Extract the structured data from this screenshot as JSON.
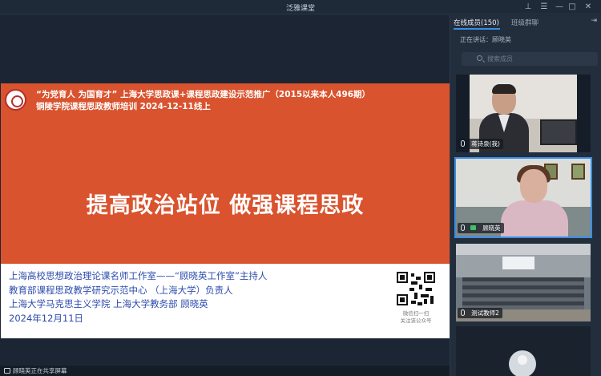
{
  "window": {
    "title": "泛雅课堂"
  },
  "slide": {
    "header_line1": "“为党育人 为国育才” 上海大学思政课+课程思政建设示范推广（2015以来本人496期）",
    "header_line2": "铜陵学院课程思政教师培训 2024-12-11线上",
    "main_title": "提高政治站位 做强课程思政",
    "body_lines": [
      "上海高校思想政治理论课名师工作室——“顾晓英工作室”主持人",
      "教育部课程思政教学研究示范中心 （上海大学）负责人",
      "上海大学马克思主义学院 上海大学教务部 顾晓英",
      "2024年12月11日"
    ],
    "qr_caption": [
      "微信扫一扫",
      "关注该公众号"
    ]
  },
  "status": {
    "sharing_text": "顾晓英正在共享屏幕"
  },
  "panel": {
    "tab_members": "在线成员(150)",
    "tab_chat": "班级群聊",
    "speaking_label": "正在讲话：顾晓英",
    "search_placeholder": "搜索成员",
    "participants": [
      {
        "name": "蒋诗泉(我)"
      },
      {
        "name": "顾晓英"
      },
      {
        "name": "测试教师2"
      },
      {
        "name": ""
      }
    ]
  },
  "colors": {
    "slide_banner": "#d9532e",
    "slide_text_blue": "#2d4cae",
    "accent": "#3a8ee6",
    "camera_on": "#42c06b"
  }
}
